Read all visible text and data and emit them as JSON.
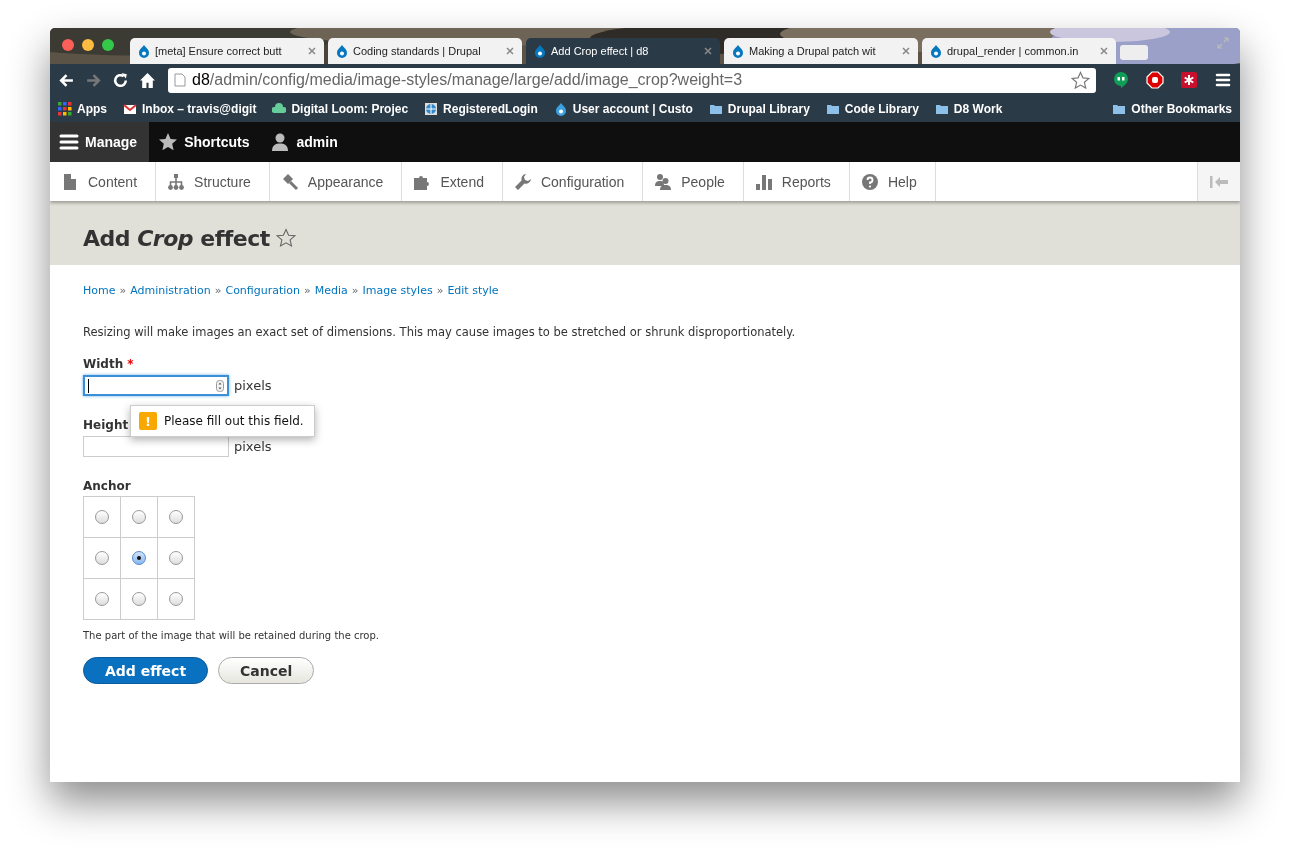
{
  "browser": {
    "tabs": [
      {
        "title": "[meta] Ensure correct butt",
        "selected": false
      },
      {
        "title": "Coding standards | Drupal",
        "selected": false
      },
      {
        "title": "Add Crop effect | d8",
        "selected": true
      },
      {
        "title": "Making a Drupal patch wit",
        "selected": false
      },
      {
        "title": "drupal_render | common.in",
        "selected": false
      }
    ],
    "url": {
      "host": "d8",
      "path": "/admin/config/media/image-styles/manage/large/add/image_crop?weight=3"
    },
    "bookmarks": [
      {
        "label": "Apps",
        "kind": "apps"
      },
      {
        "label": "Inbox – travis@digit",
        "kind": "mail"
      },
      {
        "label": "Digital Loom: Projec",
        "kind": "cloud"
      },
      {
        "label": "RegisteredLogin",
        "kind": "globe"
      },
      {
        "label": "User account | Custo",
        "kind": "drop"
      },
      {
        "label": "Drupal Library",
        "kind": "folder"
      },
      {
        "label": "Code Library",
        "kind": "folder"
      },
      {
        "label": "D8 Work",
        "kind": "folder"
      }
    ],
    "other_bookmarks": "Other Bookmarks"
  },
  "toolbar": {
    "items": [
      {
        "label": "Manage",
        "selected": true
      },
      {
        "label": "Shortcuts",
        "selected": false
      },
      {
        "label": "admin",
        "selected": false
      }
    ]
  },
  "admin_menu": {
    "items": [
      {
        "label": "Content"
      },
      {
        "label": "Structure"
      },
      {
        "label": "Appearance"
      },
      {
        "label": "Extend"
      },
      {
        "label": "Configuration"
      },
      {
        "label": "People"
      },
      {
        "label": "Reports"
      },
      {
        "label": "Help"
      }
    ]
  },
  "page": {
    "title": "Add *Crop* effect",
    "breadcrumb": [
      "Home",
      "Administration",
      "Configuration",
      "Media",
      "Image styles",
      "Edit style"
    ],
    "breadcrumb_separator": "»",
    "description": "Resizing will make images an exact set of dimensions. This may cause images to be stretched or shrunk disproportionately.",
    "fields": [
      {
        "label": "Width",
        "required": true,
        "focused": true,
        "unit": "pixels"
      },
      {
        "label": "Height",
        "required": false,
        "focused": false,
        "unit": "pixels"
      }
    ],
    "required_mark": "*",
    "validation_tooltip": {
      "icon": "!",
      "message": "Please fill out this field."
    },
    "anchor": {
      "label": "Anchor",
      "options": [
        {
          "selected": false
        },
        {
          "selected": false
        },
        {
          "selected": false
        },
        {
          "selected": false
        },
        {
          "selected": true
        },
        {
          "selected": false
        },
        {
          "selected": false
        },
        {
          "selected": false
        },
        {
          "selected": false
        }
      ],
      "description": "The part of the image that will be retained during the crop."
    },
    "buttons": [
      {
        "label": "Add effect",
        "kind": "primary"
      },
      {
        "label": "Cancel",
        "kind": "secondary"
      }
    ]
  }
}
